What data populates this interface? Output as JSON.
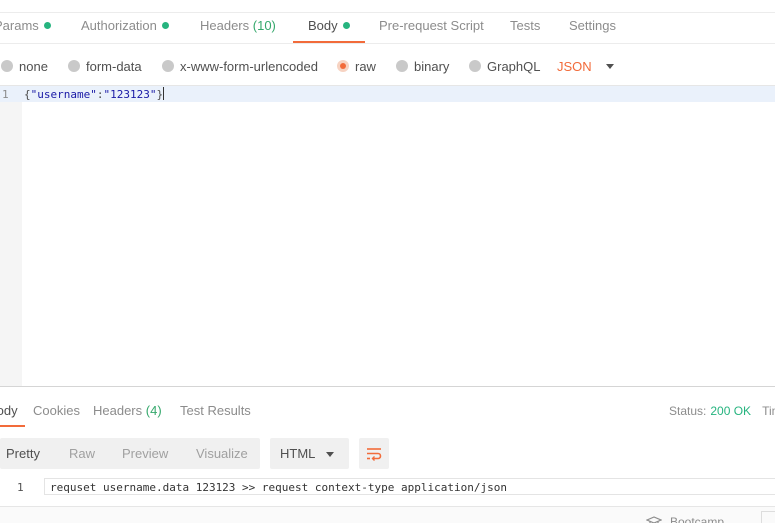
{
  "request_tabs": [
    {
      "label": "Params",
      "dot": true
    },
    {
      "label": "Authorization",
      "dot": true
    },
    {
      "label": "Headers",
      "count": "(10)"
    },
    {
      "label": "Body",
      "dot": true,
      "active": true
    },
    {
      "label": "Pre-request Script"
    },
    {
      "label": "Tests"
    },
    {
      "label": "Settings"
    }
  ],
  "body_types": [
    {
      "label": "none"
    },
    {
      "label": "form-data"
    },
    {
      "label": "x-www-form-urlencoded"
    },
    {
      "label": "raw",
      "selected": true
    },
    {
      "label": "binary"
    },
    {
      "label": "GraphQL"
    }
  ],
  "raw_format": "JSON",
  "editor": {
    "line_number": "1",
    "open": "{",
    "key": "\"username\"",
    "colon": ":",
    "value": "\"123123\"",
    "close": "}"
  },
  "response_tabs": [
    {
      "label": "Body",
      "active": true
    },
    {
      "label": "Cookies"
    },
    {
      "label": "Headers",
      "count": "(4)"
    },
    {
      "label": "Test Results"
    }
  ],
  "status": {
    "label": "Status:",
    "value": "200 OK",
    "time_label": "Time"
  },
  "view_modes": [
    "Pretty",
    "Raw",
    "Preview",
    "Visualize"
  ],
  "response_language": "HTML",
  "response_body": {
    "line_number": "1",
    "text": "requset username.data 123123 >> request context-type application/json"
  },
  "footer": {
    "bootcamp_label": "Bootcamp"
  },
  "colors": {
    "accent": "#f26b3a",
    "success": "#26b47f"
  }
}
